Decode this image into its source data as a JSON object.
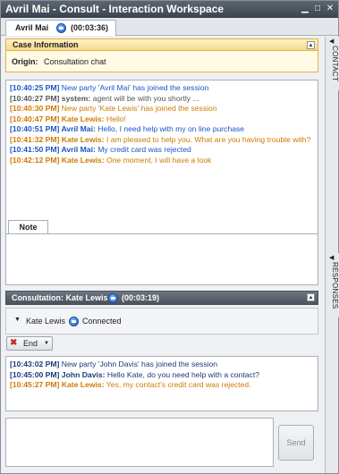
{
  "window": {
    "title": "Avril Mai - Consult - Interaction Workspace",
    "controls": [
      "minimize-icon",
      "maximize-icon",
      "close-icon"
    ]
  },
  "tab": {
    "name": "Avril Mai",
    "timer": "(00:03:36)",
    "icon": "chat-icon"
  },
  "case_info": {
    "header": "Case Information",
    "origin_label": "Origin:",
    "origin_value": "Consultation chat"
  },
  "transcript": [
    {
      "time": "[10:40:25 PM]",
      "text": "New party 'Avril Mai' has joined the session",
      "color": "blue",
      "speaker": ""
    },
    {
      "time": "[10:40:27 PM]",
      "speaker": "system:",
      "text": "agent will be with you shortly ...",
      "color": "gray"
    },
    {
      "time": "[10:40:30 PM]",
      "text": "New party 'Kate Lewis' has joined the session",
      "color": "orange",
      "speaker": ""
    },
    {
      "time": "[10:40:47 PM]",
      "speaker": "Kate Lewis:",
      "text": "Hello!",
      "color": "orange"
    },
    {
      "time": "[10:40:51 PM]",
      "speaker": "Avril Mai:",
      "text": "Hello, I need help with my on line purchase",
      "color": "blue"
    },
    {
      "time": "[10:41:32 PM]",
      "speaker": "Kate Lewis:",
      "text": "I am pleased to help you. What are you having trouble with?",
      "color": "orange"
    },
    {
      "time": "[10:41:50 PM]",
      "speaker": "Avril Mai:",
      "text": "My credit card was rejected",
      "color": "blue"
    },
    {
      "time": "[10:42:12 PM]",
      "speaker": "Kate Lewis:",
      "text": "One moment, I will have a look",
      "color": "orange"
    }
  ],
  "note": {
    "tab_label": "Note",
    "value": ""
  },
  "right_tabs": {
    "contact": "CONTACT",
    "responses": "RESPONSES"
  },
  "consultation": {
    "header": "Consultation: Kate Lewis",
    "timer": "(00:03:19)",
    "party_name": "Kate Lewis",
    "status": "Connected",
    "end_label": "End",
    "messages": [
      {
        "time": "[10:43:02 PM]",
        "speaker": "",
        "text": "New party 'John Davis' has joined the session",
        "color": "navy"
      },
      {
        "time": "[10:45:00 PM]",
        "speaker": "John Davis:",
        "text": "Hello Kate, do you need help with a contact?",
        "color": "navy"
      },
      {
        "time": "[10:45:27 PM]",
        "speaker": "Kate Lewis:",
        "text": "Yes, my contact's credit card was rejected.",
        "color": "orange"
      }
    ]
  },
  "composer": {
    "value": "",
    "send_label": "Send"
  },
  "colors": {
    "blue": "#1a55c5",
    "gray": "#555555",
    "orange": "#d07a00",
    "navy": "#1b3a7a",
    "titlebar": "#4a535d",
    "case_border": "#e8b040"
  }
}
